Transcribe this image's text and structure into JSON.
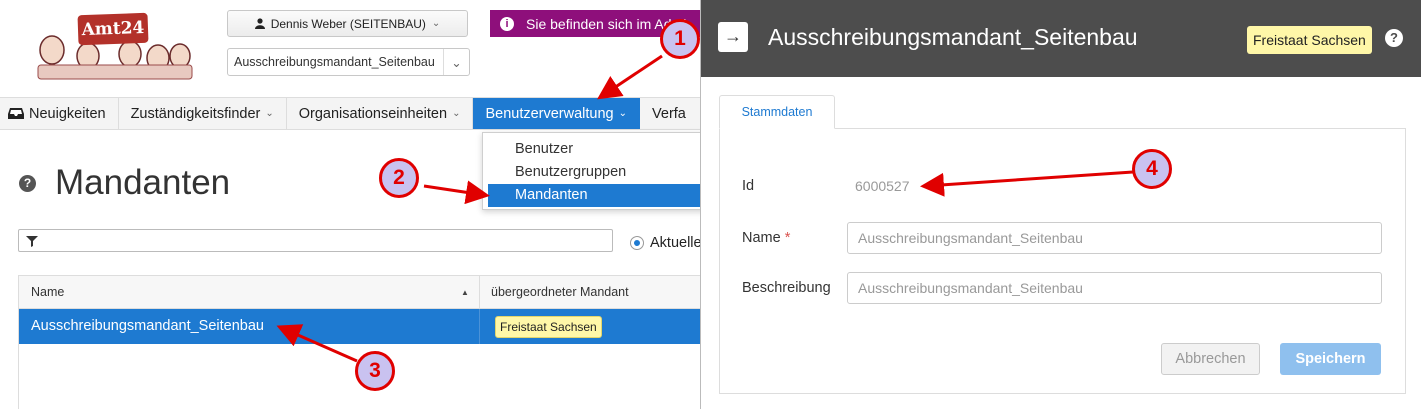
{
  "logo": {
    "text": "Amt24"
  },
  "header": {
    "user_label": "Dennis Weber (SEITENBAU)",
    "mandant_value": "Ausschreibungsmandant_Seitenbau",
    "info_text": "Sie befinden sich im Admi"
  },
  "nav": {
    "items": [
      {
        "label": "Neuigkeiten"
      },
      {
        "label": "Zuständigkeitsfinder"
      },
      {
        "label": "Organisationseinheiten"
      },
      {
        "label": "Benutzerverwaltung"
      },
      {
        "label": "Verfa"
      }
    ],
    "active_index": 3
  },
  "dropdown": {
    "items": [
      {
        "label": "Benutzer"
      },
      {
        "label": "Benutzergruppen"
      },
      {
        "label": "Mandanten"
      }
    ],
    "selected_index": 2
  },
  "page": {
    "title": "Mandanten",
    "filter_placeholder": "",
    "radio_label": "Aktueller"
  },
  "table": {
    "columns": [
      "Name",
      "übergeordneter Mandant"
    ],
    "rows": [
      {
        "name": "Ausschreibungsmandant_Seitenbau",
        "parent": "Freistaat Sachsen"
      }
    ]
  },
  "panel": {
    "title": "Ausschreibungsmandant_Seitenbau",
    "badge": "Freistaat Sachsen",
    "tab": "Stammdaten",
    "fields": {
      "id_label": "Id",
      "id_value": "6000527",
      "name_label": "Name",
      "name_required": "*",
      "name_value": "Ausschreibungsmandant_Seitenbau",
      "desc_label": "Beschreibung",
      "desc_value": "Ausschreibungsmandant_Seitenbau"
    },
    "buttons": {
      "cancel": "Abbrechen",
      "save": "Speichern"
    }
  },
  "annotations": {
    "m1": "1",
    "m2": "2",
    "m3": "3",
    "m4": "4"
  },
  "colors": {
    "primary": "#1e7ad1",
    "banner": "#8e0f7b",
    "panel_header": "#4d4d4d",
    "badge": "#fff7a8",
    "annotation": "#e00000"
  }
}
